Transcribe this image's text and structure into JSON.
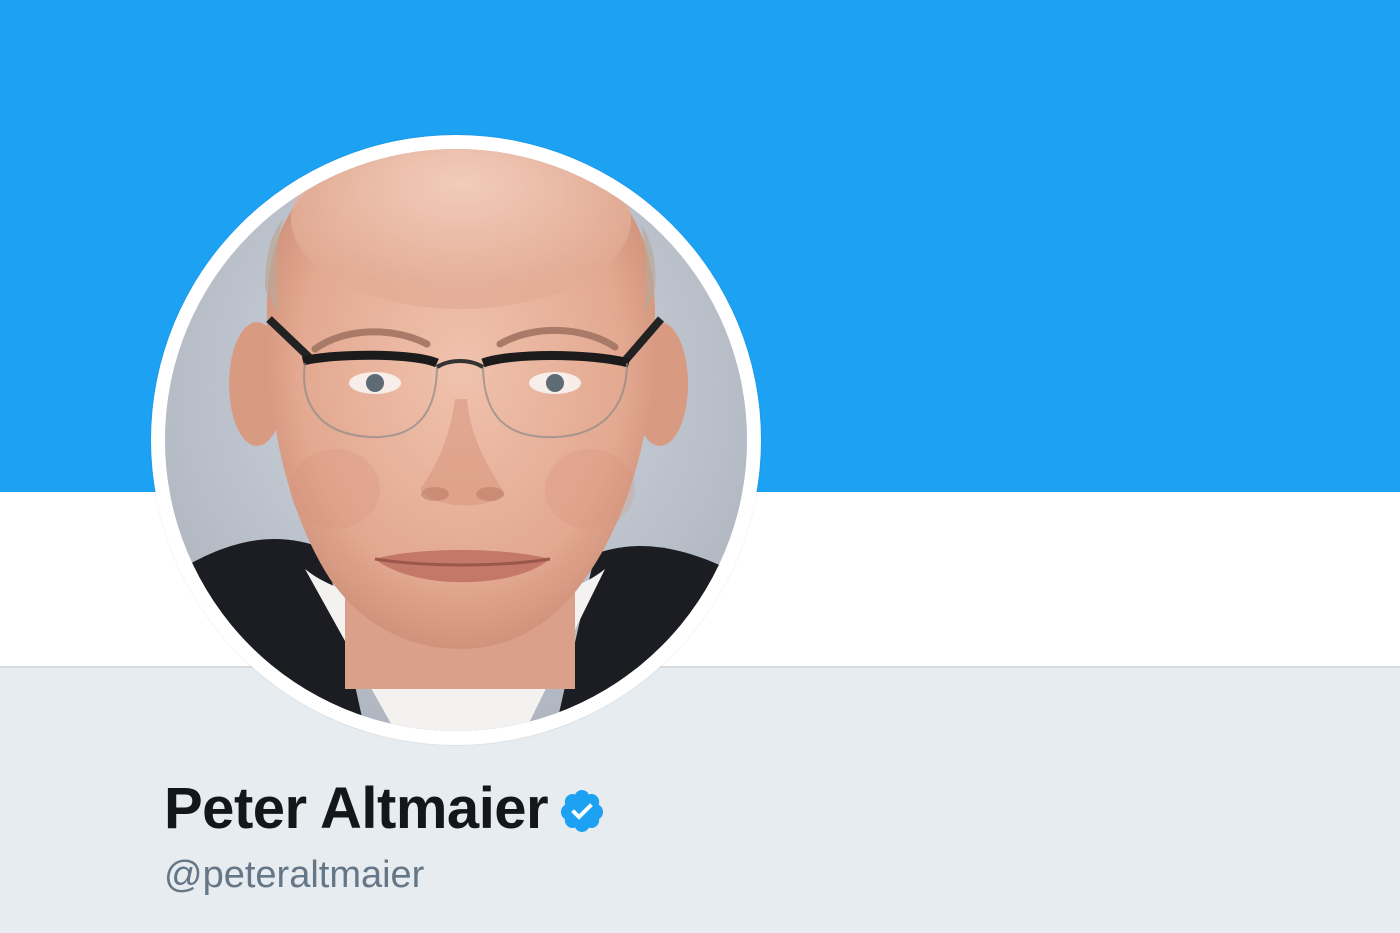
{
  "profile": {
    "name": "Peter Altmaier",
    "handle": "@peteraltmaier",
    "verified": true
  },
  "colors": {
    "banner": "#1da1f2",
    "background": "#e6ecf0",
    "name": "#14171a",
    "handle": "#657786",
    "verified_badge": "#1da1f2"
  },
  "icons": {
    "verified": "verified-badge-icon",
    "avatar": "profile-photo"
  }
}
